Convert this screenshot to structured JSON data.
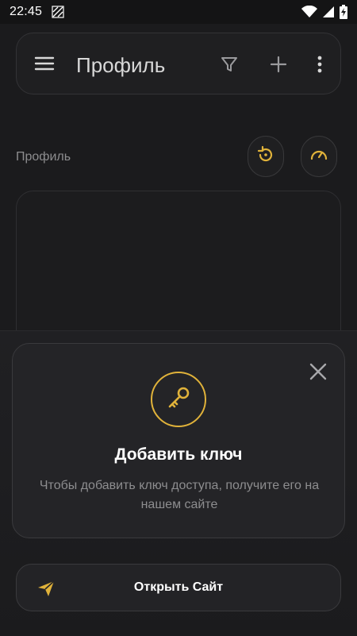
{
  "status_bar": {
    "time": "22:45"
  },
  "app_bar": {
    "title": "Профиль"
  },
  "section": {
    "label": "Профиль"
  },
  "add_key_card": {
    "title": "Добавить ключ",
    "description": "Чтобы добавить ключ доступа, получите его на нашем сайте"
  },
  "open_site_button": {
    "label": "Открыть Сайт"
  },
  "colors": {
    "accent": "#e0b23a",
    "background": "#1b1b1d",
    "card": "#242427"
  },
  "icons": [
    "menu-icon",
    "filter-icon",
    "plus-icon",
    "more-vert-icon",
    "restore-icon",
    "speedometer-icon",
    "close-icon",
    "key-icon",
    "send-icon"
  ]
}
